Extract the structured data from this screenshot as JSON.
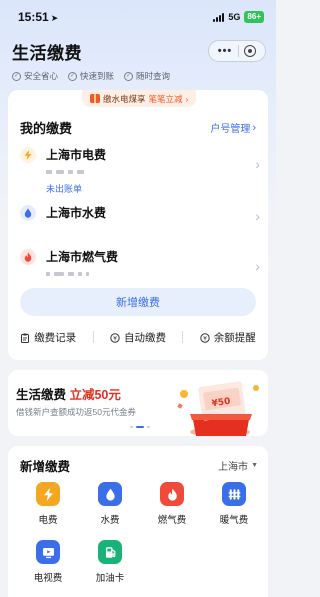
{
  "status_bar": {
    "time": "15:51",
    "network": "5G",
    "battery": "86+"
  },
  "header": {
    "title": "生活缴费",
    "more_label": "•••"
  },
  "features": [
    {
      "label": "安全省心"
    },
    {
      "label": "快速到账"
    },
    {
      "label": "随时查询"
    }
  ],
  "promo": {
    "text": "缴水电煤享",
    "highlight": "笔笔立减"
  },
  "my_bills": {
    "title": "我的缴费",
    "manage_label": "户号管理",
    "items": [
      {
        "name": "上海市电费",
        "status": "未出账单",
        "icon": "lightning-icon",
        "color": "#f5a623"
      },
      {
        "name": "上海市水费",
        "status": "",
        "icon": "water-drop-icon",
        "color": "#3a6fe8"
      },
      {
        "name": "上海市燃气费",
        "status": "",
        "icon": "flame-icon",
        "color": "#f04a3a"
      }
    ],
    "new_payment_label": "新增缴费"
  },
  "quick_actions": [
    {
      "label": "缴费记录"
    },
    {
      "label": "自动缴费"
    },
    {
      "label": "余额提醒"
    }
  ],
  "banner": {
    "title_prefix": "生活缴费 ",
    "title_highlight": "立减50元",
    "subtitle": "借钱新户查额成功返50元代金券",
    "art_text": "¥50"
  },
  "add_payment": {
    "title": "新增缴费",
    "city": "上海市",
    "services": [
      {
        "label": "电费",
        "icon": "lightning-icon",
        "color": "#f5a623"
      },
      {
        "label": "水费",
        "icon": "water-drop-icon",
        "color": "#3a6fe8"
      },
      {
        "label": "燃气费",
        "icon": "flame-icon",
        "color": "#f04a3a"
      },
      {
        "label": "暖气费",
        "icon": "radiator-icon",
        "color": "#3a6fe8"
      },
      {
        "label": "电视费",
        "icon": "tv-icon",
        "color": "#3a6fe8"
      },
      {
        "label": "加油卡",
        "icon": "fuel-pump-icon",
        "color": "#19b277"
      }
    ]
  }
}
